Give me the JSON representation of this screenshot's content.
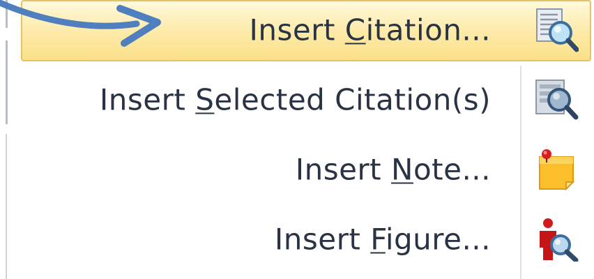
{
  "context_menu": {
    "items": [
      {
        "pre": "Insert ",
        "mnemonic": "C",
        "post": "itation...",
        "icon": "citation-search-icon",
        "highlighted": true
      },
      {
        "pre": "Insert ",
        "mnemonic": "S",
        "post": "elected Citation(s)",
        "icon": "selected-citation-search-icon",
        "highlighted": false
      },
      {
        "pre": "Insert ",
        "mnemonic": "N",
        "post": "ote...",
        "icon": "sticky-note-icon",
        "highlighted": false
      },
      {
        "pre": "Insert ",
        "mnemonic": "F",
        "post": "igure...",
        "icon": "figure-search-icon",
        "highlighted": false
      }
    ]
  },
  "colors": {
    "highlight_fill": "#fdeaa6",
    "highlight_border": "#e5c365",
    "text": "#2a3344",
    "arrow": "#4f7fbf"
  }
}
